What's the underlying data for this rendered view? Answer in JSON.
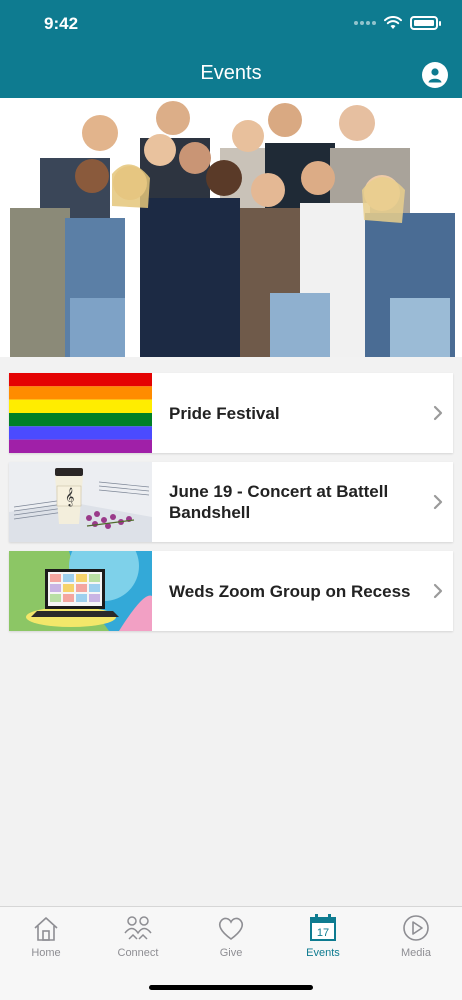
{
  "status_bar": {
    "time": "9:42"
  },
  "header": {
    "title": "Events"
  },
  "events": [
    {
      "title": "Pride Festival"
    },
    {
      "title": "June 19 - Concert at Battell Bandshell"
    },
    {
      "title": "Weds Zoom Group on Recess"
    }
  ],
  "tabs": [
    {
      "label": "Home",
      "icon": "home-icon"
    },
    {
      "label": "Connect",
      "icon": "connect-icon"
    },
    {
      "label": "Give",
      "icon": "heart-icon"
    },
    {
      "label": "Events",
      "icon": "calendar-icon",
      "active": true,
      "badge": "17"
    },
    {
      "label": "Media",
      "icon": "play-icon"
    }
  ],
  "colors": {
    "brand": "#0e7b90",
    "tab_inactive": "#8e8e93"
  }
}
